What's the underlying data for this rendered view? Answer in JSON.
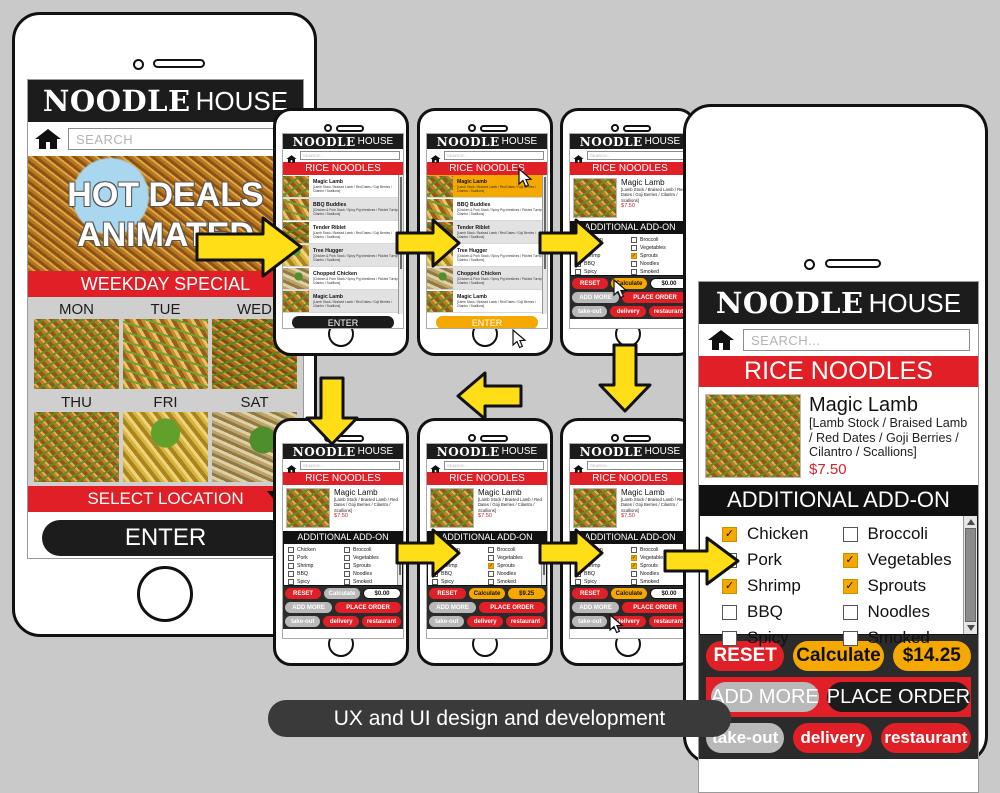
{
  "brand": {
    "word1": "NOODLE",
    "word2": "HOUSE"
  },
  "caption": {
    "text": "UX and UI design and development"
  },
  "colors": {
    "red": "#e02026",
    "yellow": "#f5a800",
    "dark": "#1c1c1c",
    "grey": "#b9b9b9",
    "background": "#c9c9c9"
  },
  "main_phone": {
    "search_placeholder": "SEARCH",
    "hero_line1": "HOT DEALS",
    "hero_line2": "ANIMATED",
    "weekday_title": "WEEKDAY SPECIAL",
    "days": [
      "MON",
      "TUE",
      "WED",
      "THU",
      "FRI",
      "SAT"
    ],
    "select_location": "SELECT LOCATION",
    "enter_label": "ENTER"
  },
  "detail_phone": {
    "search_placeholder": "SEARCH...",
    "section_title": "RICE NOODLES",
    "product": {
      "name": "Magic Lamb",
      "description": "[Lamb Stock / Braised Lamb / Red Dates / Goji Berries / Cilantro / Scallions]",
      "price": "$7.50"
    },
    "addon_title": "ADDITIONAL ADD-ON",
    "addons": [
      {
        "label": "Chicken",
        "checked": true
      },
      {
        "label": "Broccoli",
        "checked": false
      },
      {
        "label": "Pork",
        "checked": false
      },
      {
        "label": "Vegetables",
        "checked": true
      },
      {
        "label": "Shrimp",
        "checked": true
      },
      {
        "label": "Sprouts",
        "checked": true
      },
      {
        "label": "BBQ",
        "checked": false
      },
      {
        "label": "Noodles",
        "checked": false
      },
      {
        "label": "Spicy",
        "checked": false
      },
      {
        "label": "Smoked",
        "checked": false
      }
    ],
    "buttons": {
      "reset": "RESET",
      "calculate": "Calculate",
      "total": "$14.25",
      "add_more": "ADD MORE",
      "place_order": "PLACE ORDER",
      "take_out": "take-out",
      "delivery": "delivery",
      "restaurant": "restaurant"
    }
  },
  "menu_items": [
    {
      "name": "Magic Lamb",
      "desc": "[Lamb Stock / Braised Lamb / Red Dates / Goji Berries / Cilantro / Scallions]"
    },
    {
      "name": "BBQ Buddies",
      "desc": "[Chicken & Pork Stock / Spicy Pig Intestines / Pickled Turnip / Cilantro / Scallions]"
    },
    {
      "name": "Tender Riblet",
      "desc": "[Lamb Stock / Braised Lamb / Red Dates / Goji Berries / Cilantro / Scallions]"
    },
    {
      "name": "Tree Hugger",
      "desc": "[Chicken & Pork Stock / Spicy Pig Intestines / Pickled Turnip / Cilantro / Scallions]"
    },
    {
      "name": "Chopped Chicken",
      "desc": "[Chicken & Pork Stock / Spicy Pig Intestines / Pickled Turnip / Cilantro / Scallions]"
    },
    {
      "name": "Magic Lamb",
      "desc": "[Lamb Stock / Braised Lamb / Red Dates / Goji Berries / Cilantro / Scallions]"
    }
  ],
  "flow_phones": [
    {
      "id": "list",
      "screen": "menu-list",
      "search_placeholder": "SEARCH...",
      "section_title": "RICE NOODLES",
      "enter_label": "ENTER",
      "enter_style": "dark",
      "selected_index": -1,
      "cursor": null
    },
    {
      "id": "list-selected",
      "screen": "menu-list",
      "search_placeholder": "SEARCH...",
      "section_title": "RICE NOODLES",
      "enter_label": "ENTER",
      "enter_style": "yellow",
      "selected_index": 0,
      "cursor": "on-item-and-enter"
    },
    {
      "id": "detail-partial",
      "screen": "detail",
      "search_placeholder": "SEARCH...",
      "section_title": "RICE NOODLES",
      "addon_title": "ADDITIONAL ADD-ON",
      "checked": [
        "Chicken",
        "Sprouts"
      ],
      "calculate_style": "yellow",
      "total": "$0.00",
      "cursor": "below-checkboxes"
    },
    {
      "id": "detail-empty",
      "screen": "detail",
      "search_placeholder": "SEARCH...",
      "section_title": "RICE NOODLES",
      "addon_title": "ADDITIONAL ADD-ON",
      "checked": [],
      "calculate_style": "grey",
      "total": "$0.00",
      "cursor": null
    },
    {
      "id": "detail-two",
      "screen": "detail",
      "search_placeholder": "SEARCH...",
      "section_title": "RICE NOODLES",
      "addon_title": "ADDITIONAL ADD-ON",
      "checked": [
        "Chicken",
        "Sprouts"
      ],
      "calculate_style": "yellow",
      "total": "$9.25",
      "cursor": null
    },
    {
      "id": "detail-four",
      "screen": "detail",
      "search_placeholder": "SEARCH...",
      "section_title": "RICE NOODLES",
      "addon_title": "ADDITIONAL ADD-ON",
      "checked": [
        "Chicken",
        "Shrimp",
        "Vegetables",
        "Sprouts"
      ],
      "calculate_style": "yellow",
      "total": "$0.00",
      "cursor": "on-calculate"
    }
  ],
  "small_buttons": {
    "reset": "RESET",
    "calculate": "Calculate",
    "add_more": "ADD MORE",
    "place_order": "PLACE ORDER",
    "take_out": "take-out",
    "delivery": "delivery",
    "restaurant": "restaurant"
  },
  "small_product": {
    "name": "Magic Lamb",
    "description": "[Lamb Stock / Braised Lamb / Red Dates / Goji Berries / Cilantro / Scallions]",
    "price": "$7.50"
  },
  "arrows": [
    {
      "name": "arrow-list-to-selected",
      "dir": "right"
    },
    {
      "name": "arrow-selected-to-detail",
      "dir": "right"
    },
    {
      "name": "arrow-detail-down",
      "dir": "down"
    },
    {
      "name": "arrow-hero-right",
      "dir": "right"
    },
    {
      "name": "arrow-down-to-bottomrow",
      "dir": "down"
    },
    {
      "name": "arrow-bottom-left",
      "dir": "left"
    },
    {
      "name": "arrow-bottom-right-1",
      "dir": "right"
    },
    {
      "name": "arrow-bottom-right-2",
      "dir": "right"
    },
    {
      "name": "arrow-to-big-detail",
      "dir": "right"
    }
  ]
}
